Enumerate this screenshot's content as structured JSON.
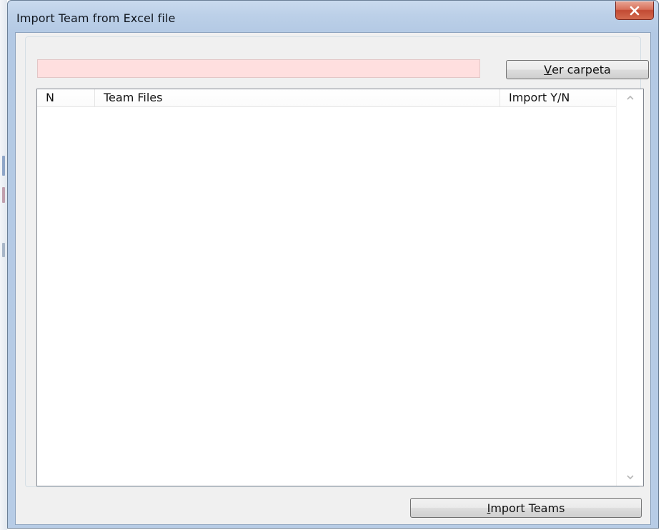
{
  "window": {
    "title": "Import Team from Excel file",
    "close_icon": "close-icon"
  },
  "path_input": {
    "value": "",
    "placeholder": "",
    "background_color": "#ffdfdf"
  },
  "folder_button": {
    "mnemonic": "V",
    "label_rest": "er carpeta"
  },
  "team_list": {
    "columns": [
      "N",
      "Team Files",
      "Import Y/N"
    ],
    "rows": []
  },
  "import_button": {
    "mnemonic": "I",
    "label_rest": "mport Teams"
  },
  "scrollbar": {
    "up_icon": "scroll-up-arrow-icon",
    "down_icon": "scroll-down-arrow-icon"
  }
}
